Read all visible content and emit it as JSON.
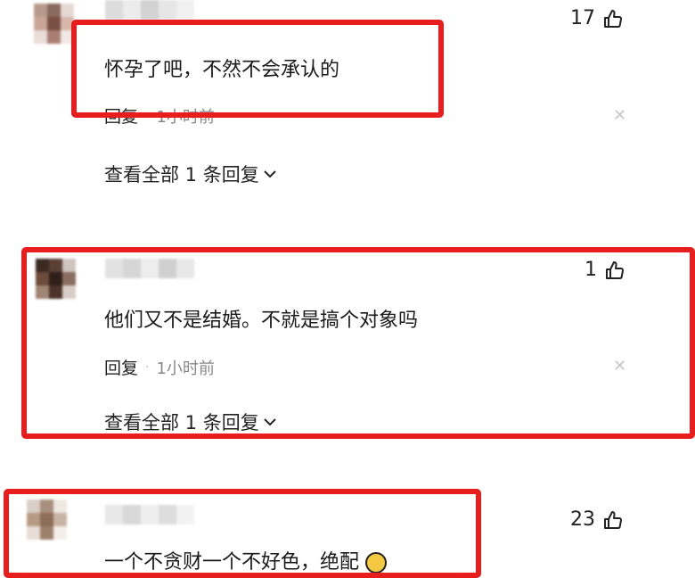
{
  "comments": [
    {
      "likes": "17",
      "content": "怀孕了吧，不然不会承认的",
      "reply_label": "回复",
      "time": "1小时前",
      "expand_label": "查看全部 1 条回复"
    },
    {
      "likes": "1",
      "content": "他们又不是结婚。不就是搞个对象吗",
      "reply_label": "回复",
      "time": "1小时前",
      "expand_label": "查看全部 1 条回复"
    },
    {
      "likes": "23",
      "content": "一个不贪财一个不好色，绝配"
    }
  ],
  "colors": {
    "highlight_frame": "#e81e1e"
  },
  "icons": {
    "like": "thumbs-up-icon",
    "dismiss": "close-icon",
    "expand": "chevron-down-icon"
  }
}
